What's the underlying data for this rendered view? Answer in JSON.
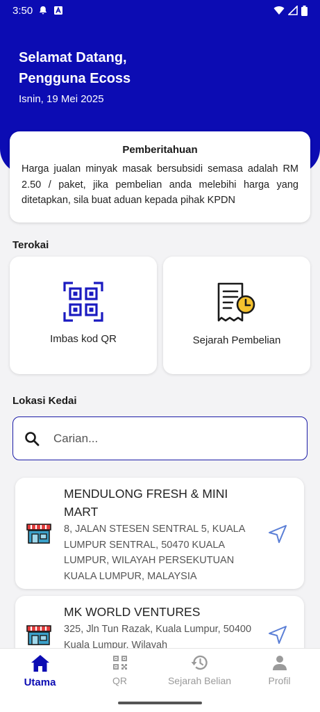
{
  "status_bar": {
    "time": "3:50",
    "icons": [
      "notification-bell-icon",
      "a-badge-icon",
      "wifi-icon",
      "signal-icon",
      "battery-icon"
    ]
  },
  "header": {
    "welcome_line1": "Selamat Datang,",
    "welcome_line2": "Pengguna Ecoss",
    "date": "Isnin, 19 Mei 2025"
  },
  "notice": {
    "title": "Pemberitahuan",
    "body": "Harga jualan minyak masak bersubsidi semasa adalah RM 2.50 / paket, jika pembelian anda melebihi harga yang ditetapkan, sila buat aduan kepada pihak KPDN"
  },
  "explore": {
    "label": "Terokai",
    "cards": [
      {
        "label": "Imbas kod QR",
        "icon": "qr-scan-icon"
      },
      {
        "label": "Sejarah Pembelian",
        "icon": "receipt-history-icon"
      }
    ]
  },
  "locations": {
    "label": "Lokasi Kedai",
    "search_placeholder": "Carian...",
    "shops": [
      {
        "name": "MENDULONG FRESH & MINI MART",
        "address": "8, JALAN STESEN SENTRAL 5, KUALA LUMPUR SENTRAL, 50470 KUALA LUMPUR, WILAYAH PERSEKUTUAN KUALA LUMPUR, MALAYSIA"
      },
      {
        "name": "MK WORLD VENTURES",
        "address": "325, Jln Tun Razak, Kuala Lumpur, 50400 Kuala Lumpur, Wilayah"
      }
    ]
  },
  "bottom_nav": {
    "items": [
      {
        "label": "Utama",
        "icon": "home-icon",
        "active": true
      },
      {
        "label": "QR",
        "icon": "qr-icon",
        "active": false
      },
      {
        "label": "Sejarah Belian",
        "icon": "history-icon",
        "active": false
      },
      {
        "label": "Profil",
        "icon": "person-icon",
        "active": false
      }
    ]
  },
  "colors": {
    "primary": "#0c0cb3",
    "background": "#f3f3f5",
    "accent_yellow": "#f5c22e",
    "navigate_blue": "#5b7fd6"
  }
}
